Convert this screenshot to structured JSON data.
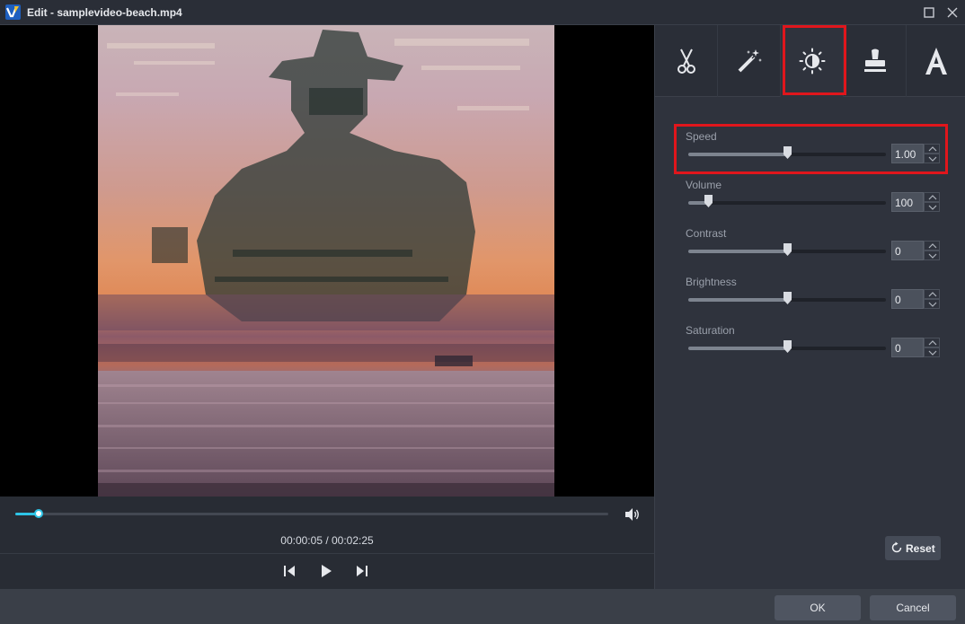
{
  "window": {
    "title": "Edit - samplevideo-beach.mp4"
  },
  "player": {
    "timecode": "00:00:05 / 00:02:25",
    "progress_fraction": 0.04
  },
  "tools": [
    {
      "name": "cut",
      "icon": "scissors-icon"
    },
    {
      "name": "effects",
      "icon": "magic-wand-icon"
    },
    {
      "name": "adjust",
      "icon": "brightness-contrast-icon",
      "active": true
    },
    {
      "name": "watermark",
      "icon": "stamp-icon"
    },
    {
      "name": "text",
      "icon": "text-icon"
    }
  ],
  "params": {
    "speed": {
      "label": "Speed",
      "value": "1.00",
      "slider_fraction": 0.5
    },
    "volume": {
      "label": "Volume",
      "value": "100",
      "slider_fraction": 0.1
    },
    "contrast": {
      "label": "Contrast",
      "value": "0",
      "slider_fraction": 0.5
    },
    "brightness": {
      "label": "Brightness",
      "value": "0",
      "slider_fraction": 0.5
    },
    "saturation": {
      "label": "Saturation",
      "value": "0",
      "slider_fraction": 0.5
    }
  },
  "panel": {
    "reset_label": "Reset"
  },
  "footer": {
    "ok_label": "OK",
    "cancel_label": "Cancel"
  },
  "colors": {
    "accent": "#2ec4e6",
    "highlight_box": "#e0161c",
    "panel_bg": "#2f333d"
  }
}
